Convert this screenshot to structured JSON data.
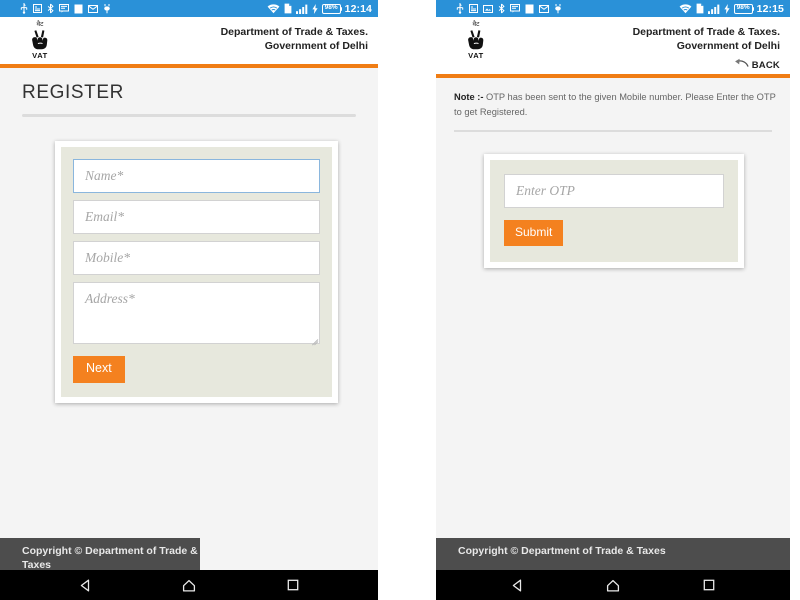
{
  "screens": [
    {
      "id": "register-screen",
      "statusbar": {
        "icons": [
          "usb-icon",
          "sd-card-icon",
          "bluetooth-icon",
          "sms-icon",
          "app-icon",
          "email-icon",
          "usb-debug-icon"
        ],
        "wifi_icon": "wifi-icon",
        "sim_icon": "sim-card-icon",
        "signal_icon": "signal-bars-icon",
        "charging_icon": "charging-bolt-icon",
        "battery_level": "98%",
        "time": "12:14"
      },
      "header": {
        "logo_hindi": "वैट",
        "logo_mark": "hand-victory-icon",
        "logo_label": "VAT",
        "dept_line1": "Department of Trade & Taxes.",
        "dept_line2": "Government of Delhi",
        "back_label": "",
        "back_icon": ""
      },
      "page_title": "REGISTER",
      "form": {
        "fields": [
          {
            "name": "name-field",
            "placeholder": "Name*",
            "value": "",
            "focused": true
          },
          {
            "name": "email-field",
            "placeholder": "Email*",
            "value": "",
            "focused": false
          },
          {
            "name": "mobile-field",
            "placeholder": "Mobile*",
            "value": "",
            "focused": false
          }
        ],
        "textarea": {
          "name": "address-field",
          "placeholder": "Address*",
          "value": ""
        },
        "submit_label": "Next"
      },
      "footer": "Copyright © Department of Trade & Taxes",
      "navbar": {
        "back": "nav-back-icon",
        "home": "nav-home-icon",
        "recents": "nav-recents-icon"
      }
    },
    {
      "id": "otp-screen",
      "statusbar": {
        "icons": [
          "usb-icon",
          "sd-card-icon",
          "screenshot-icon",
          "bluetooth-icon",
          "sms-icon",
          "app-icon",
          "email-icon",
          "usb-debug-icon"
        ],
        "wifi_icon": "wifi-icon",
        "sim_icon": "sim-card-icon",
        "signal_icon": "signal-bars-icon",
        "charging_icon": "charging-bolt-icon",
        "battery_level": "98%",
        "time": "12:15"
      },
      "header": {
        "logo_hindi": "वैट",
        "logo_mark": "hand-victory-icon",
        "logo_label": "VAT",
        "dept_line1": "Department of Trade & Taxes.",
        "dept_line2": "Government of Delhi",
        "back_label": "BACK",
        "back_icon": "back-arrow-icon"
      },
      "note": {
        "label": "Note :-",
        "text": " OTP has been sent to the given Mobile number. Please Enter the OTP to get Registered."
      },
      "form": {
        "fields": [
          {
            "name": "otp-field",
            "placeholder": "Enter OTP",
            "value": "",
            "focused": false
          }
        ],
        "submit_label": "Submit"
      },
      "footer": "Copyright © Department of Trade & Taxes",
      "navbar": {
        "back": "nav-back-icon",
        "home": "nav-home-icon",
        "recents": "nav-recents-icon"
      }
    }
  ],
  "colors": {
    "statusbar": "#2a91d8",
    "accent_orange": "#f4811f",
    "divider_orange": "#f07d14",
    "page_bg": "#f4f4f4",
    "card_bg": "#e7e8dd",
    "footer_bg": "#4d4d4d",
    "navbar_bg": "#000000",
    "focus_border": "#8ab6dd"
  }
}
